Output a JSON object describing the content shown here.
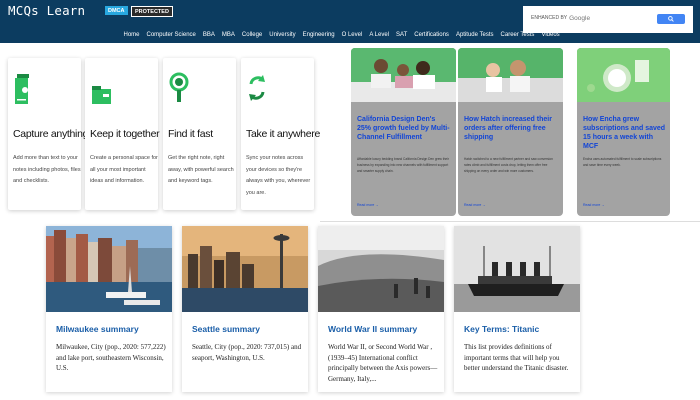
{
  "header": {
    "logo": "MCQs Learn",
    "dmca_badge": "DMCA",
    "protected_badge": "PROTECTED",
    "search": {
      "enhanced_label": "ENHANCED BY",
      "google_label": "Google",
      "button_icon": "search-icon"
    },
    "nav": [
      "Home",
      "Computer Science",
      "BBA",
      "MBA",
      "College",
      "University",
      "Engineering",
      "O Level",
      "A Level",
      "SAT",
      "Certifications",
      "Aptitude Tests",
      "Career Tests",
      "Videos"
    ],
    "background": "#0c3c60"
  },
  "features": [
    {
      "title": "Capture anything",
      "desc": "Add more than text to your notes including photos, files and checklists.",
      "icon": "note-icon",
      "color": "#2dbe60"
    },
    {
      "title": "Keep it together",
      "desc": "Create a personal space for all your most important ideas and information.",
      "icon": "notebook-icon",
      "color": "#2dbe60"
    },
    {
      "title": "Find it fast",
      "desc": "Get the right note, right away, with powerful search and keyword tags.",
      "icon": "search-magnifier-icon",
      "color": "#2dbe60"
    },
    {
      "title": "Take it anywhere",
      "desc": "Sync your notes across your devices so they're always with you, wherever you are.",
      "icon": "sync-icon",
      "color": "#2dbe60"
    }
  ],
  "ads": [
    {
      "title": "California Design Den's 25% growth fueled by Multi-Channel Fulfillment",
      "body": "Affordable luxury bedding brand California Design Den grew their business by expanding into new channels with fulfillment support and smarter supply chain.",
      "link": "Read more →"
    },
    {
      "title": "How Hatch increased their orders after offering free shipping",
      "body": "Hatch switched to a new fulfillment partner and saw conversion rates climb and fulfillment costs drop, letting them offer free shipping on every order and win more customers.",
      "link": "Read more →"
    },
    {
      "title": "How Encha grew subscriptions and saved 15 hours a week with MCF",
      "body": "Encha uses automated fulfillment to scale subscriptions and save time every week.",
      "link": "Read more →"
    }
  ],
  "articles": [
    {
      "title": "Milwaukee summary",
      "desc": "Milwaukee, City (pop., 2020: 577,222) and lake port, southeastern Wisconsin, U.S."
    },
    {
      "title": "Seattle summary",
      "desc": "Seattle, City (pop., 2020: 737,015) and seaport, Washington, U.S."
    },
    {
      "title": "World War II summary",
      "desc": "World War II, or Second World War , (1939–45) International conflict principally between the Axis powers—Germany, Italy,..."
    },
    {
      "title": "Key Terms: Titanic",
      "desc": "This list provides definitions of important terms that will help you better understand the Titanic disaster."
    }
  ]
}
